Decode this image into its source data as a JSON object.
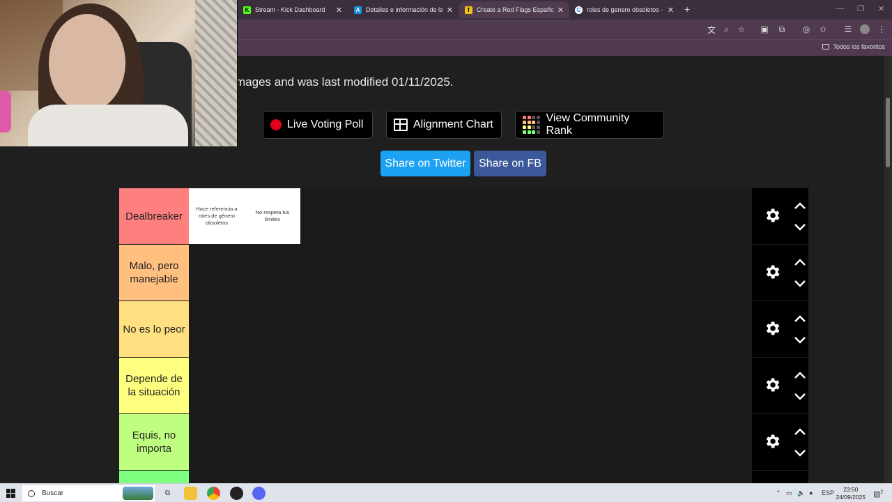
{
  "browser": {
    "tabs": [
      {
        "title": "Stream - Kick Dashboard",
        "favicon_color": "#53fc18",
        "favicon_letter": "K"
      },
      {
        "title": "Detalles e información de la ev",
        "favicon_color": "#1e8fe0",
        "favicon_letter": "A"
      },
      {
        "title": "Create a Red Flags Español Tier",
        "favicon_color": "#f0c419",
        "favicon_letter": "T",
        "active": true
      },
      {
        "title": "roles de genero obsoletos - Bu",
        "favicon_color": "#ffffff",
        "favicon_letter": "G"
      }
    ],
    "new_tab": "+",
    "bookmarks_folder": "Todos los favoritos"
  },
  "page": {
    "modified_text": "mages and was last modified 01/11/2025.",
    "buttons": {
      "live_voting": "Live Voting Poll",
      "alignment": "Alignment Chart",
      "community_rank": "View Community Rank"
    },
    "share": {
      "twitter": "Share on Twitter",
      "twitter_color": "#1da1f2",
      "fb": "Share on FB",
      "fb_color": "#3b5998"
    }
  },
  "tiers": [
    {
      "label": "Dealbreaker",
      "color": "#ff7f7f",
      "items": [
        "Hace referencia a roles de género obsoletos",
        "No respeta tus límites"
      ]
    },
    {
      "label": "Malo, pero manejable",
      "color": "#ffbf7f",
      "items": []
    },
    {
      "label": "No es lo peor",
      "color": "#ffdf7f",
      "items": []
    },
    {
      "label": "Depende de la situación",
      "color": "#ffff7f",
      "items": []
    },
    {
      "label": "Equis, no importa",
      "color": "#bfff7f",
      "items": []
    },
    {
      "label": "",
      "color": "#7fff7f",
      "items": []
    }
  ],
  "taskbar": {
    "search_placeholder": "Buscar",
    "language": "ESP",
    "time": "23:50",
    "date": "24/09/2025",
    "notification_count": "2"
  }
}
